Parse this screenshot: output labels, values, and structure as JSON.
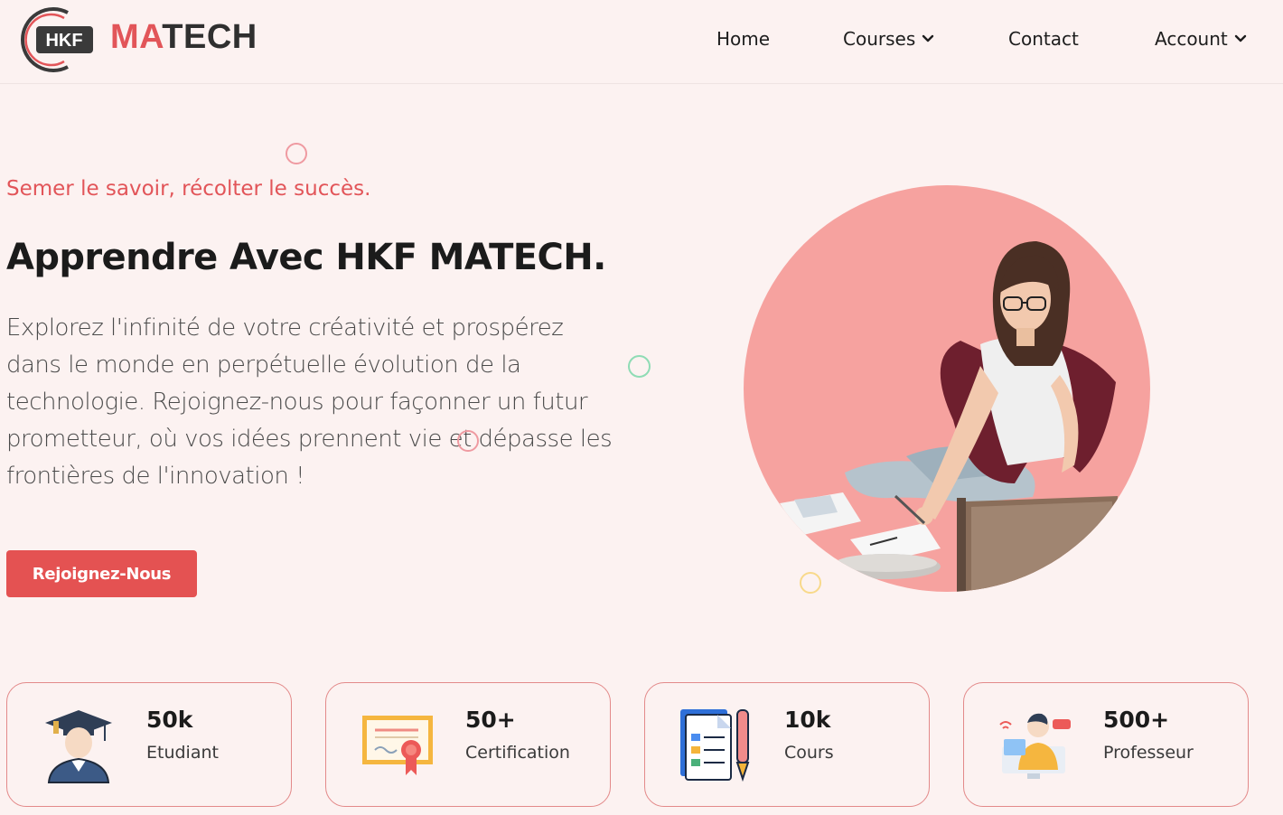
{
  "brand": {
    "badge": "HKF",
    "name_accent": "MA",
    "name_rest": "TECH"
  },
  "nav": {
    "items": [
      {
        "label": "Home",
        "has_dropdown": false
      },
      {
        "label": "Courses",
        "has_dropdown": true
      },
      {
        "label": "Contact",
        "has_dropdown": false
      },
      {
        "label": "Account",
        "has_dropdown": true
      }
    ]
  },
  "hero": {
    "tagline": "Semer le savoir, récolter le succès.",
    "title": "Apprendre Avec HKF MATECH.",
    "description": "Explorez l'infinité de votre créativité et prospérez dans le monde en perpétuelle évolution de la technologie. Rejoignez-nous pour façonner un futur prometteur, où vos idées prennent vie et dépasse les frontières de l'innovation !",
    "cta_label": "Rejoignez-Nous",
    "image": "student-sitting-with-laptop-illustration"
  },
  "stats": [
    {
      "value": "50k",
      "label": "Etudiant",
      "icon": "graduate-student-icon"
    },
    {
      "value": "50+",
      "label": "Certification",
      "icon": "certificate-icon"
    },
    {
      "value": "10k",
      "label": "Cours",
      "icon": "course-document-icon"
    },
    {
      "value": "500+",
      "label": "Professeur",
      "icon": "teacher-live-icon"
    }
  ],
  "colors": {
    "accent": "#e45252",
    "background": "#fcf2f1",
    "hero_circle": "#f6a29f",
    "card_border": "#e38a8a",
    "ring_pink": "#ef9aa1",
    "ring_green": "#8fdcb5",
    "ring_yellow": "#f8d98a"
  }
}
